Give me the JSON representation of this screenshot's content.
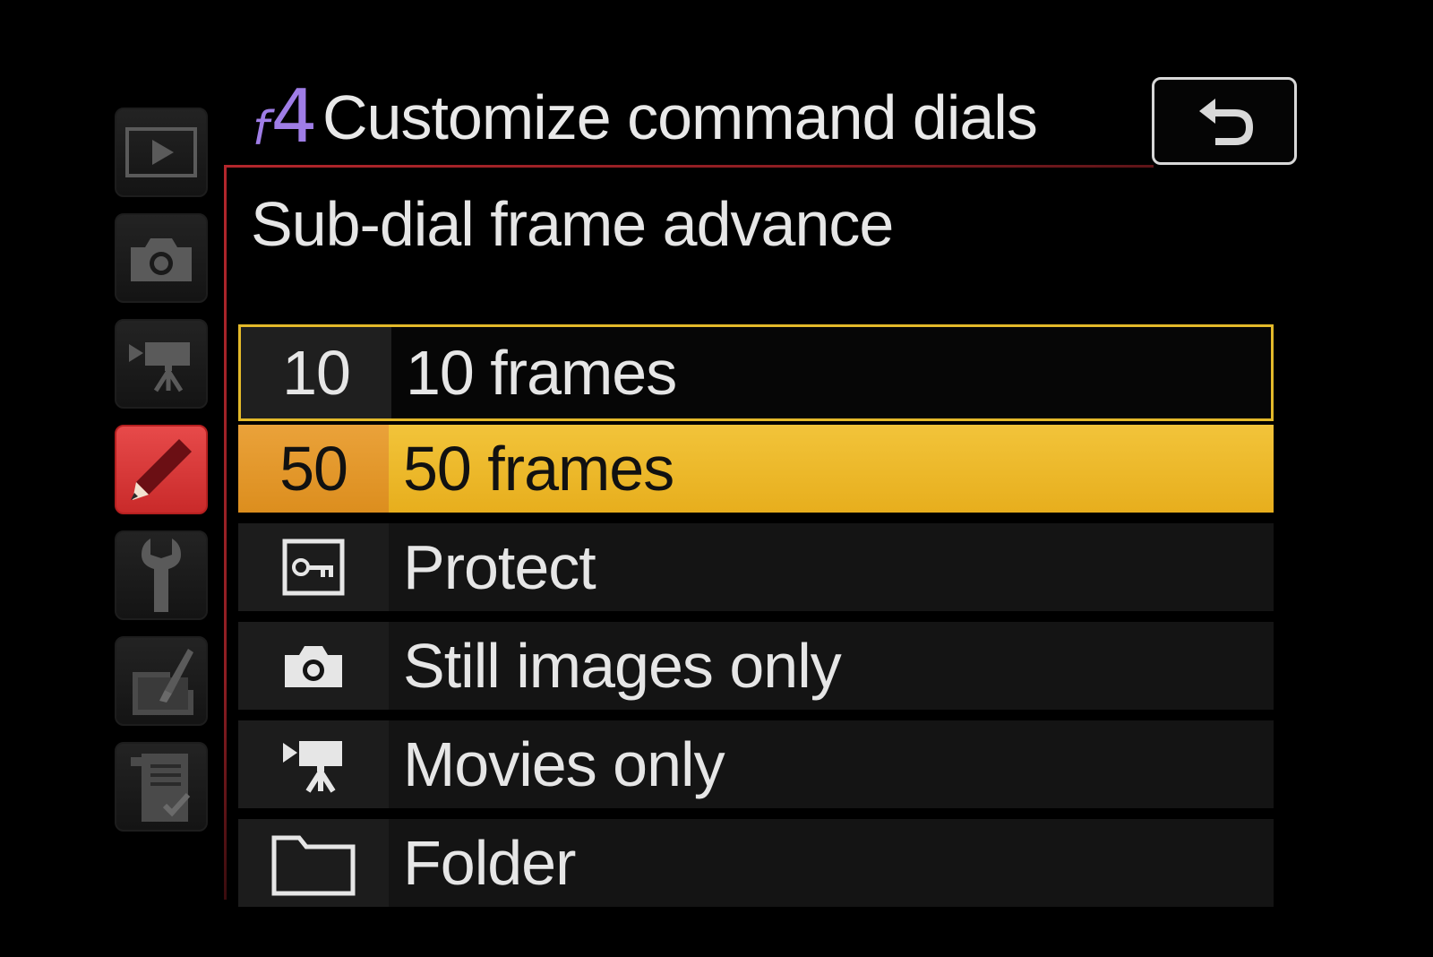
{
  "header": {
    "code_letter": "f",
    "code_number": "4",
    "title": "Customize command dials"
  },
  "subtitle": "Sub-dial frame advance",
  "tabs": [
    {
      "name": "playback",
      "icon": "play-icon"
    },
    {
      "name": "photo-shooting",
      "icon": "camera-icon"
    },
    {
      "name": "movie-shooting",
      "icon": "movie-camera-icon"
    },
    {
      "name": "custom-settings",
      "icon": "pencil-icon",
      "active": true
    },
    {
      "name": "setup",
      "icon": "wrench-icon"
    },
    {
      "name": "retouch",
      "icon": "retouch-brush-icon"
    },
    {
      "name": "my-menu",
      "icon": "checklist-icon"
    }
  ],
  "options": [
    {
      "code": "10",
      "label": "10 frames",
      "state": "focused"
    },
    {
      "code": "50",
      "label": "50 frames",
      "state": "selected"
    },
    {
      "code": "",
      "icon": "protect-key-icon",
      "label": "Protect"
    },
    {
      "code": "",
      "icon": "camera-icon",
      "label": "Still images only"
    },
    {
      "code": "",
      "icon": "movie-camera-icon",
      "label": "Movies only"
    },
    {
      "code": "",
      "icon": "folder-icon",
      "label": "Folder"
    }
  ],
  "colors": {
    "accent_purple": "#9f7de6",
    "focus_border": "#e3b92a",
    "selected_fill": "#f2c43a",
    "active_tab": "#e03e3e"
  }
}
